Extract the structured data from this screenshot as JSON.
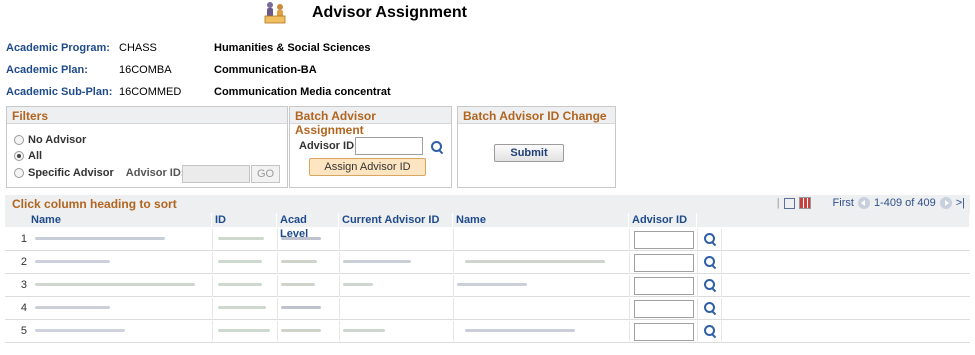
{
  "page": {
    "title": "Advisor Assignment"
  },
  "info": [
    {
      "label": "Academic Program:",
      "code": "CHASS",
      "desc": "Humanities & Social Sciences"
    },
    {
      "label": "Academic Plan:",
      "code": "16COMBA",
      "desc": "Communication-BA"
    },
    {
      "label": "Academic Sub-Plan:",
      "code": "16COMMED",
      "desc": "Communication Media concentrat"
    }
  ],
  "filters": {
    "title": "Filters",
    "options": [
      "No Advisor",
      "All",
      "Specific Advisor"
    ],
    "selected": "All",
    "advisor_id_label": "Advisor ID:",
    "go_label": "GO"
  },
  "batch_assign": {
    "title": "Batch Advisor Assignment",
    "advisor_id_label": "Advisor ID:",
    "button_label": "Assign Advisor ID"
  },
  "batch_change": {
    "title": "Batch Advisor ID Change",
    "button_label": "Submit"
  },
  "grid": {
    "title": "Click column heading to sort",
    "nav_first": "First",
    "nav_range": "1-409 of 409",
    "nav_last": ">|",
    "columns": [
      "Name",
      "ID",
      "Acad Level",
      "Current Advisor ID",
      "Name",
      "Advisor ID"
    ],
    "row_numbers": [
      "1",
      "2",
      "3",
      "4",
      "5"
    ]
  }
}
